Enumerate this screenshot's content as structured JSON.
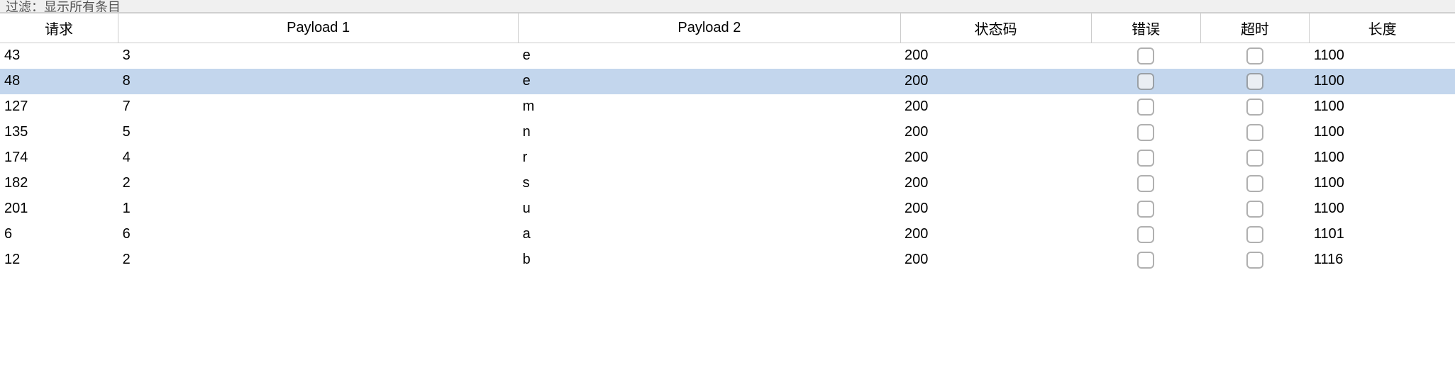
{
  "toolbar": {
    "filter_label": "过滤：显示所有条目"
  },
  "columns": {
    "request": "请求",
    "payload1": "Payload 1",
    "payload2": "Payload 2",
    "status": "状态码",
    "error": "错误",
    "timeout": "超时",
    "length": "长度"
  },
  "rows": [
    {
      "request": "43",
      "payload1": "3",
      "payload2": "e",
      "status": "200",
      "error": false,
      "timeout": false,
      "length": "1100",
      "selected": false
    },
    {
      "request": "48",
      "payload1": "8",
      "payload2": "e",
      "status": "200",
      "error": false,
      "timeout": false,
      "length": "1100",
      "selected": true
    },
    {
      "request": "127",
      "payload1": "7",
      "payload2": "m",
      "status": "200",
      "error": false,
      "timeout": false,
      "length": "1100",
      "selected": false
    },
    {
      "request": "135",
      "payload1": "5",
      "payload2": "n",
      "status": "200",
      "error": false,
      "timeout": false,
      "length": "1100",
      "selected": false
    },
    {
      "request": "174",
      "payload1": "4",
      "payload2": "r",
      "status": "200",
      "error": false,
      "timeout": false,
      "length": "1100",
      "selected": false
    },
    {
      "request": "182",
      "payload1": "2",
      "payload2": "s",
      "status": "200",
      "error": false,
      "timeout": false,
      "length": "1100",
      "selected": false
    },
    {
      "request": "201",
      "payload1": "1",
      "payload2": "u",
      "status": "200",
      "error": false,
      "timeout": false,
      "length": "1100",
      "selected": false
    },
    {
      "request": "6",
      "payload1": "6",
      "payload2": "a",
      "status": "200",
      "error": false,
      "timeout": false,
      "length": "1101",
      "selected": false
    },
    {
      "request": "12",
      "payload1": "2",
      "payload2": "b",
      "status": "200",
      "error": false,
      "timeout": false,
      "length": "1116",
      "selected": false
    }
  ]
}
